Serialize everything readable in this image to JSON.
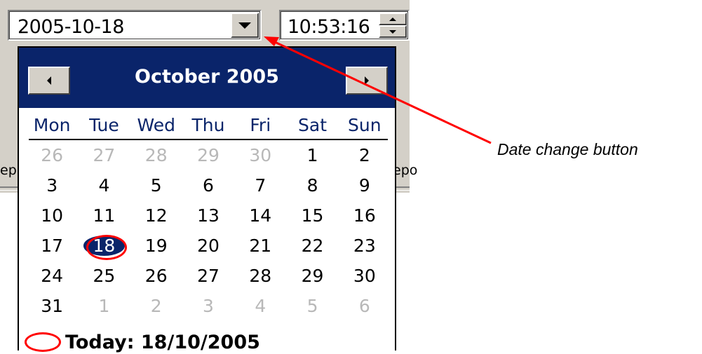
{
  "date_picker": {
    "value": "2005-10-18",
    "dropdown_icon": "chevron-down-icon"
  },
  "time_picker": {
    "value": "10:53:16"
  },
  "background_fragments": {
    "left": "ep",
    "right": "epo"
  },
  "calendar": {
    "month_title": "October 2005",
    "prev_icon": "arrow-left-icon",
    "next_icon": "arrow-right-icon",
    "weekdays": [
      "Mon",
      "Tue",
      "Wed",
      "Thu",
      "Fri",
      "Sat",
      "Sun"
    ],
    "weeks": [
      [
        {
          "d": "26",
          "other": true
        },
        {
          "d": "27",
          "other": true
        },
        {
          "d": "28",
          "other": true
        },
        {
          "d": "29",
          "other": true
        },
        {
          "d": "30",
          "other": true
        },
        {
          "d": "1"
        },
        {
          "d": "2"
        }
      ],
      [
        {
          "d": "3"
        },
        {
          "d": "4"
        },
        {
          "d": "5"
        },
        {
          "d": "6"
        },
        {
          "d": "7"
        },
        {
          "d": "8"
        },
        {
          "d": "9"
        }
      ],
      [
        {
          "d": "10"
        },
        {
          "d": "11"
        },
        {
          "d": "12"
        },
        {
          "d": "13"
        },
        {
          "d": "14"
        },
        {
          "d": "15"
        },
        {
          "d": "16"
        }
      ],
      [
        {
          "d": "17"
        },
        {
          "d": "18",
          "selected": true
        },
        {
          "d": "19"
        },
        {
          "d": "20"
        },
        {
          "d": "21"
        },
        {
          "d": "22"
        },
        {
          "d": "23"
        }
      ],
      [
        {
          "d": "24"
        },
        {
          "d": "25"
        },
        {
          "d": "26"
        },
        {
          "d": "27"
        },
        {
          "d": "28"
        },
        {
          "d": "29"
        },
        {
          "d": "30"
        }
      ],
      [
        {
          "d": "31"
        },
        {
          "d": "1",
          "other": true
        },
        {
          "d": "2",
          "other": true
        },
        {
          "d": "3",
          "other": true
        },
        {
          "d": "4",
          "other": true
        },
        {
          "d": "5",
          "other": true
        },
        {
          "d": "6",
          "other": true
        }
      ]
    ],
    "today_label": "Today: 18/10/2005"
  },
  "annotation": {
    "label": "Date change button",
    "color": "#ff0000"
  },
  "colors": {
    "header_bg": "#0a246a",
    "dialog_bg": "#d4d0c8",
    "other_month": "#b8b8b8",
    "highlight": "#ff0000"
  }
}
